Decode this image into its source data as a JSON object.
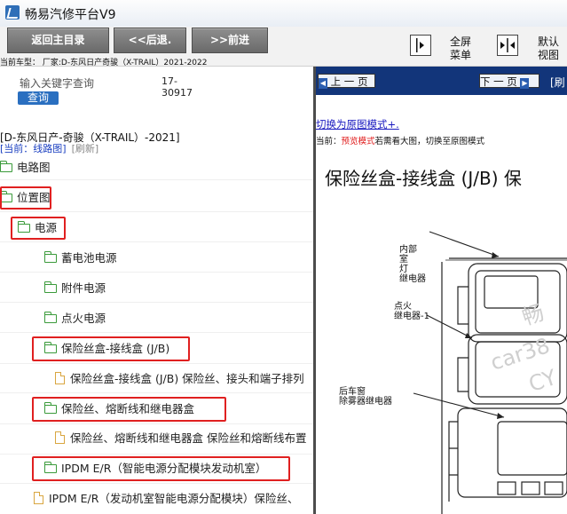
{
  "window": {
    "title": "畅易汽修平台V9"
  },
  "toolbar": {
    "back_home": "返回主目录",
    "back": "<<后退.",
    "forward": ">>前进",
    "fullscreen_menu": [
      "全屏",
      "菜单"
    ],
    "default_view": [
      "默认",
      "视图"
    ],
    "vehicle_line": "当前车型：  厂家:D-东风日产奇骏（X-TRAIL）2021-2022"
  },
  "search": {
    "label": "输入关键字查询",
    "code": [
      "17-",
      "30917"
    ],
    "button": "查询"
  },
  "tree": {
    "vehicle": "[D-东风日产-奇骏（X-TRAIL）-2021]",
    "path": "[当前：线路图]",
    "refresh": "[刷新]",
    "items": [
      {
        "label": "电路图",
        "kind": "folder"
      },
      {
        "label": "位置图",
        "kind": "folder"
      },
      {
        "label": "电源",
        "kind": "folder"
      },
      {
        "label": "蓄电池电源",
        "kind": "folder"
      },
      {
        "label": "附件电源",
        "kind": "folder"
      },
      {
        "label": "点火电源",
        "kind": "folder"
      },
      {
        "label": "保险丝盒-接线盒 (J/B)",
        "kind": "folder"
      },
      {
        "label": "保险丝盒-接线盒 (J/B) 保险丝、接头和端子排列",
        "kind": "doc"
      },
      {
        "label": "保险丝、熔断线和继电器盒",
        "kind": "folder"
      },
      {
        "label": "保险丝、熔断线和继电器盒 保险丝和熔断线布置",
        "kind": "doc"
      },
      {
        "label": "IPDM E/R（智能电源分配模块发动机室）",
        "kind": "folder"
      },
      {
        "label": "IPDM E/R（发动机室智能电源分配模块）保险丝、",
        "kind": "doc"
      }
    ]
  },
  "viewer": {
    "prev": "上 一 页",
    "next": "下 一 页",
    "extra": "[刷",
    "switch_link": "切换为原图模式+.",
    "mode_prefix": "当前：",
    "mode_value": "预览模式",
    "mode_suffix": "若需看大图，切换至原图模式",
    "heading": "保险丝盒-接线盒 (J/B) 保",
    "labels": {
      "interior_lamp_relay": [
        "内部",
        "室",
        "灯",
        "继电器"
      ],
      "ignition_relay": [
        "点火",
        "继电器-1"
      ],
      "rear_defogger_relay": [
        "后车窗",
        "除雾器继电器"
      ]
    },
    "watermark": [
      "畅",
      "car38",
      "CY"
    ]
  },
  "colors": {
    "accent": "#e02020",
    "folder": "#3a9a3a",
    "doc": "#d9a640",
    "link": "#1a3fc0"
  }
}
